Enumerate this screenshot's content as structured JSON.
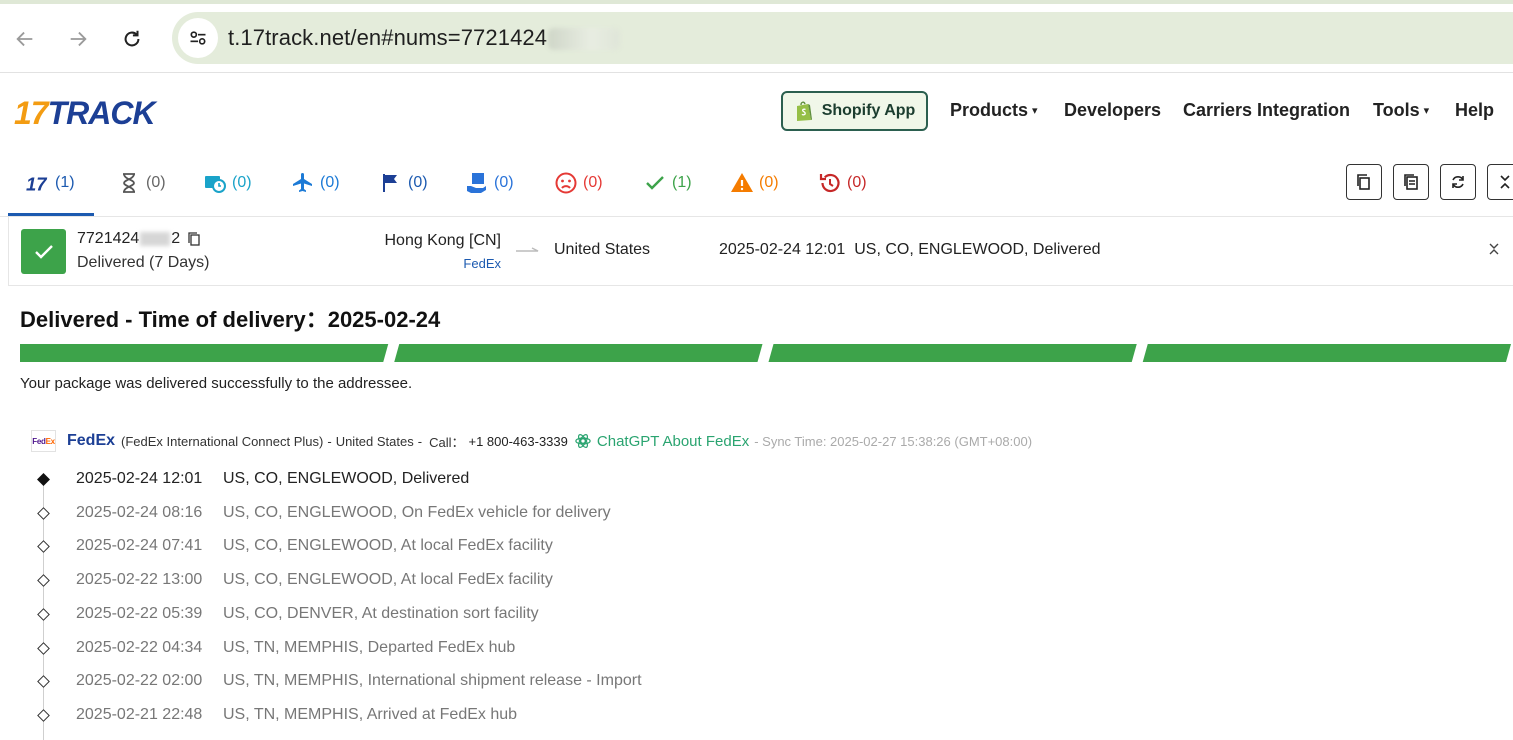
{
  "browser": {
    "url_visible": "t.17track.net/en#nums=772142",
    "url_suffix_blurred": "4",
    "back_icon": "arrow-left-icon",
    "forward_icon": "arrow-right-icon",
    "reload_icon": "reload-icon",
    "site_info_icon": "tune-icon"
  },
  "header": {
    "logo_17": "17",
    "logo_track": "TRACK",
    "shopify_label": "Shopify App",
    "menu": [
      {
        "label": "Products",
        "has_caret": true
      },
      {
        "label": "Developers",
        "has_caret": false
      },
      {
        "label": "Carriers Integration",
        "has_caret": false
      },
      {
        "label": "Tools",
        "has_caret": true
      },
      {
        "label": "Help",
        "has_caret": false
      }
    ],
    "caret": "▾"
  },
  "tabs": [
    {
      "icon": "17-logo-icon",
      "count": "(1)",
      "color": "#1c5ab0"
    },
    {
      "icon": "hourglass-icon",
      "count": "(0)",
      "color": "#666666"
    },
    {
      "icon": "truck-clock-icon",
      "count": "(0)",
      "color": "#1aa3c9"
    },
    {
      "icon": "airplane-icon",
      "count": "(0)",
      "color": "#1c7ad6"
    },
    {
      "icon": "flag-icon",
      "count": "(0)",
      "color": "#1c5ab0"
    },
    {
      "icon": "package-hand-icon",
      "count": "(0)",
      "color": "#2a73d9"
    },
    {
      "icon": "sad-face-icon",
      "count": "(0)",
      "color": "#e53935"
    },
    {
      "icon": "check-icon",
      "count": "(1)",
      "color": "#3da34a"
    },
    {
      "icon": "warning-icon",
      "count": "(0)",
      "color": "#f57c00"
    },
    {
      "icon": "history-icon",
      "count": "(0)",
      "color": "#c62828"
    }
  ],
  "tools": [
    {
      "icon": "copy-icon"
    },
    {
      "icon": "copy-list-icon"
    },
    {
      "icon": "refresh-icon"
    },
    {
      "icon": "collapse-icon"
    }
  ],
  "summary": {
    "tracking_prefix": "7721424",
    "tracking_suffix": "2",
    "status_text": "Delivered (7 Days)",
    "origin": "Hong Kong [CN]",
    "origin_carrier": "FedEx",
    "destination": "United States",
    "last_event": "2025-02-24 12:01  US, CO, ENGLEWOOD, Delivered",
    "status_color": "#3da34a"
  },
  "detail": {
    "title": "Delivered - Time of delivery：2025-02-24",
    "progress_color": "#3da34a",
    "progress_segments_filled": 4,
    "progress_segments_total": 4,
    "message": "Your package was delivered successfully to the addressee."
  },
  "carrier": {
    "logo_fe": "Fed",
    "logo_ex": "Ex",
    "name": "FedEx",
    "service": "(FedEx International Connect Plus)",
    "sep1": "-",
    "country": "United States",
    "sep2": "-",
    "call_label": "Call：",
    "phone": "+1 800-463-3339",
    "chatgpt_label": "ChatGPT About FedEx",
    "sync_time": "- Sync Time: 2025-02-27 15:38:26 (GMT+08:00)"
  },
  "events": [
    {
      "time": "2025-02-24 12:01",
      "desc": "US, CO, ENGLEWOOD, Delivered"
    },
    {
      "time": "2025-02-24 08:16",
      "desc": "US, CO, ENGLEWOOD, On FedEx vehicle for delivery"
    },
    {
      "time": "2025-02-24 07:41",
      "desc": "US, CO, ENGLEWOOD, At local FedEx facility"
    },
    {
      "time": "2025-02-22 13:00",
      "desc": "US, CO, ENGLEWOOD, At local FedEx facility"
    },
    {
      "time": "2025-02-22 05:39",
      "desc": "US, CO, DENVER, At destination sort facility"
    },
    {
      "time": "2025-02-22 04:34",
      "desc": "US, TN, MEMPHIS, Departed FedEx hub"
    },
    {
      "time": "2025-02-22 02:00",
      "desc": "US, TN, MEMPHIS, International shipment release - Import"
    },
    {
      "time": "2025-02-21 22:48",
      "desc": "US, TN, MEMPHIS, Arrived at FedEx hub"
    }
  ]
}
